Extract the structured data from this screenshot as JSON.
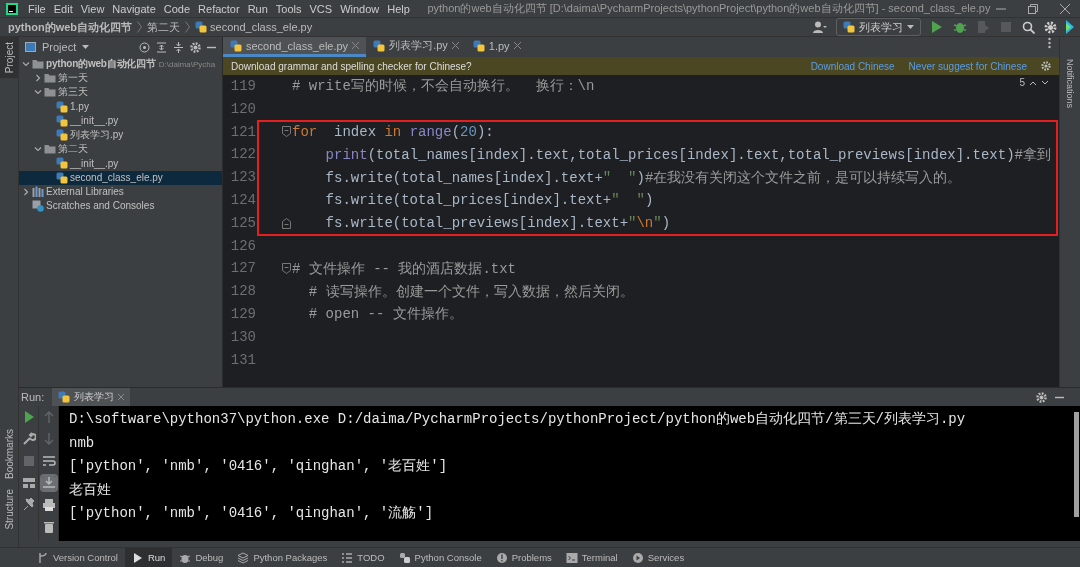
{
  "menu": [
    "File",
    "Edit",
    "View",
    "Navigate",
    "Code",
    "Refactor",
    "Run",
    "Tools",
    "VCS",
    "Window",
    "Help"
  ],
  "window": {
    "title": "python的web自动化四节 [D:\\daima\\PycharmProjects\\pythonProject\\python的web自动化四节] - second_class_ele.py"
  },
  "breadcrumb": [
    "python的web自动化四节",
    "第二天",
    "second_class_ele.py"
  ],
  "run_config": {
    "label": "列表学习"
  },
  "toolbar_actions": [
    {
      "disabled": false
    },
    {
      "disabled": false
    },
    {
      "disabled": true
    },
    {
      "disabled": true
    }
  ],
  "left_strip": {
    "top": [
      {
        "label": "Project",
        "selected": true
      }
    ],
    "bottom": [
      {
        "label": "Bookmarks"
      },
      {
        "label": "Structure"
      }
    ]
  },
  "project": {
    "title": "Project",
    "tree": [
      {
        "label": "python的web自动化四节",
        "path": "D:\\daima\\Pycha",
        "kind": "folder",
        "expanded": true,
        "selected": false,
        "children": [
          {
            "label": "第一天",
            "kind": "folder",
            "expanded": false,
            "selected": false
          },
          {
            "label": "第三天",
            "kind": "folder",
            "expanded": true,
            "selected": false,
            "children": [
              {
                "label": "1.py",
                "kind": "file",
                "selected": false
              },
              {
                "label": "__init__.py",
                "kind": "file",
                "selected": false
              },
              {
                "label": "列表学习.py",
                "kind": "file",
                "selected": false
              }
            ]
          },
          {
            "label": "第二天",
            "kind": "folder",
            "expanded": true,
            "selected": false,
            "children": [
              {
                "label": "__init__.py",
                "kind": "file",
                "selected": false
              },
              {
                "label": "second_class_ele.py",
                "kind": "file",
                "selected": true
              }
            ]
          }
        ]
      },
      {
        "label": "External Libraries",
        "kind": "library",
        "expanded": false,
        "selected": false
      },
      {
        "label": "Scratches and Consoles",
        "kind": "scratches",
        "selected": false
      }
    ]
  },
  "editor": {
    "tabs": [
      {
        "label": "second_class_ele.py",
        "selected": true
      },
      {
        "label": "列表学习.py",
        "selected": false
      },
      {
        "label": "1.py",
        "selected": false
      }
    ],
    "notification": {
      "text": "Download grammar and spelling checker for Chinese?",
      "links": [
        "Download Chinese",
        "Never suggest for Chinese"
      ]
    },
    "problems_count": "5",
    "lines": [
      {
        "number": "119",
        "kind": "plain",
        "highlighted": false,
        "tokens": [
          {
            "kind": "comment",
            "text": "# write写的时候，不会自动换行。  换行：\\n"
          }
        ]
      },
      {
        "number": "120",
        "kind": "plain",
        "highlighted": false
      },
      {
        "number": "121",
        "kind": "fold_start",
        "highlighted": true,
        "tokens": [
          {
            "kind": "keyword",
            "text": "for"
          },
          {
            "kind": "plain",
            "text": "  index "
          },
          {
            "kind": "keyword",
            "text": "in "
          },
          {
            "kind": "builtin",
            "text": "range"
          },
          {
            "kind": "plain",
            "text": "("
          },
          {
            "kind": "number",
            "text": "20"
          },
          {
            "kind": "plain",
            "text": "):"
          }
        ]
      },
      {
        "number": "122",
        "kind": "plain",
        "highlighted": true,
        "tokens": [
          {
            "kind": "builtin",
            "text": "    print"
          },
          {
            "kind": "plain",
            "text": "(total_names[index].text,total_prices[index].text,total_previews[index].text)"
          },
          {
            "kind": "comment",
            "text": "#拿到"
          }
        ]
      },
      {
        "number": "123",
        "kind": "plain",
        "highlighted": true,
        "tokens": [
          {
            "kind": "plain",
            "text": "    fs.write(total_names[index].text+"
          },
          {
            "kind": "string",
            "text": "\"  \""
          },
          {
            "kind": "plain",
            "text": ")"
          },
          {
            "kind": "comment",
            "text": "#在我没有关闭这个文件之前，是可以持续写入的。"
          }
        ]
      },
      {
        "number": "124",
        "kind": "plain",
        "highlighted": true,
        "tokens": [
          {
            "kind": "plain",
            "text": "    fs.write(total_prices[index].text+"
          },
          {
            "kind": "string",
            "text": "\"  \""
          },
          {
            "kind": "plain",
            "text": ")"
          }
        ]
      },
      {
        "number": "125",
        "kind": "fold_end",
        "highlighted": true,
        "tokens": [
          {
            "kind": "plain",
            "text": "    fs.write(total_previews[index].text+"
          },
          {
            "kind": "string",
            "text": "\""
          },
          {
            "kind": "escape",
            "text": "\\n"
          },
          {
            "kind": "string",
            "text": "\""
          },
          {
            "kind": "plain",
            "text": ")"
          }
        ]
      },
      {
        "number": "126",
        "kind": "plain",
        "highlighted": false
      },
      {
        "number": "127",
        "kind": "fold_start",
        "highlighted": false,
        "tokens": [
          {
            "kind": "comment",
            "text": "# 文件操作 -- 我的酒店数据.txt"
          }
        ]
      },
      {
        "number": "128",
        "kind": "plain",
        "highlighted": false,
        "tokens": [
          {
            "kind": "comment",
            "text": "  # 读写操作。创建一个文件，写入数据，然后关闭。"
          }
        ]
      },
      {
        "number": "129",
        "kind": "plain",
        "highlighted": false,
        "tokens": [
          {
            "kind": "comment",
            "text": "  # open -- 文件操作。"
          }
        ]
      },
      {
        "number": "130",
        "kind": "plain",
        "highlighted": false
      },
      {
        "number": "131",
        "kind": "plain",
        "highlighted": false
      }
    ]
  },
  "right_strip": {
    "label": "Notifications"
  },
  "run": {
    "label": "Run:",
    "tab": "列表学习",
    "tools_a": [
      {
        "disabled": false
      },
      {
        "disabled": false
      },
      {
        "disabled": true
      },
      {
        "disabled": false
      },
      {
        "disabled": false
      }
    ],
    "tools_b": [
      {
        "disabled": true
      },
      {
        "disabled": true
      },
      {
        "disabled": false,
        "on": false
      },
      {
        "disabled": false,
        "on": true
      },
      {
        "disabled": false
      },
      {
        "disabled": false
      }
    ],
    "output": [
      "D:\\software\\python37\\python.exe D:/daima/PycharmProjects/pythonProject/python的web自动化四节/第三天/列表学习.py",
      "nmb",
      "['python', 'nmb', '0416', 'qinghan', '老百姓']",
      "老百姓",
      "['python', 'nmb', '0416', 'qinghan', '流觞']"
    ]
  },
  "tool_windows": [
    {
      "label": "Version Control",
      "selected": false
    },
    {
      "label": "Run",
      "selected": true
    },
    {
      "label": "Debug",
      "selected": false
    },
    {
      "label": "Python Packages",
      "selected": false
    },
    {
      "label": "TODO",
      "selected": false
    },
    {
      "label": "Python Console",
      "selected": false
    },
    {
      "label": "Problems",
      "selected": false
    },
    {
      "label": "Terminal",
      "selected": false
    },
    {
      "label": "Services",
      "selected": false
    }
  ]
}
